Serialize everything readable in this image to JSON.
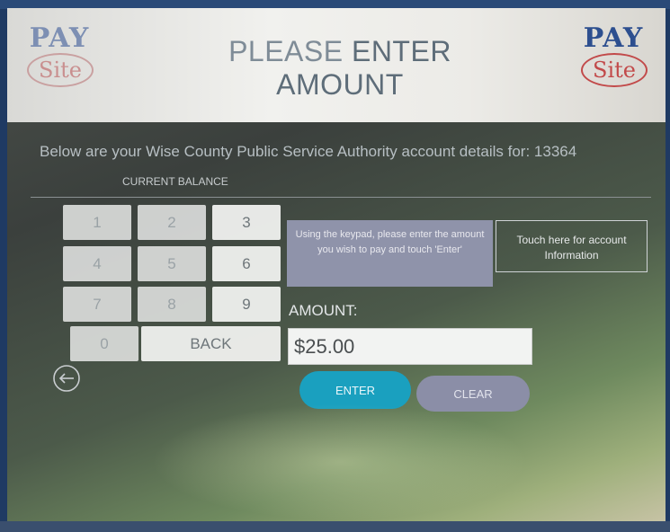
{
  "header": {
    "title_part1": "PLEASE ",
    "title_part2": "ENTER AMOUNT",
    "logo_left": {
      "pay": "PAY",
      "site": "Site"
    },
    "logo_right": {
      "pay": "PAY",
      "site": "Site"
    }
  },
  "account": {
    "details_line": "Below are your Wise County Public Service Authority account details for: 13364",
    "current_balance_label": "CURRENT BALANCE"
  },
  "keypad": {
    "keys": [
      "1",
      "2",
      "3",
      "4",
      "5",
      "6",
      "7",
      "8",
      "9",
      "0"
    ],
    "back_label": "BACK"
  },
  "instructions": "Using the keypad, please enter the amount you wish to pay and touch 'Enter'",
  "account_info_button": "Touch here for account Information",
  "amount": {
    "label": "AMOUNT:",
    "value": "$25.00"
  },
  "actions": {
    "enter_label": "ENTER",
    "clear_label": "CLEAR"
  },
  "icons": {
    "back_navigation": "arrow-left-circle-icon"
  },
  "colors": {
    "enter_button": "#1aa0bf",
    "clear_button": "#8b8ea7",
    "instruction_box": "#8f93aa"
  }
}
